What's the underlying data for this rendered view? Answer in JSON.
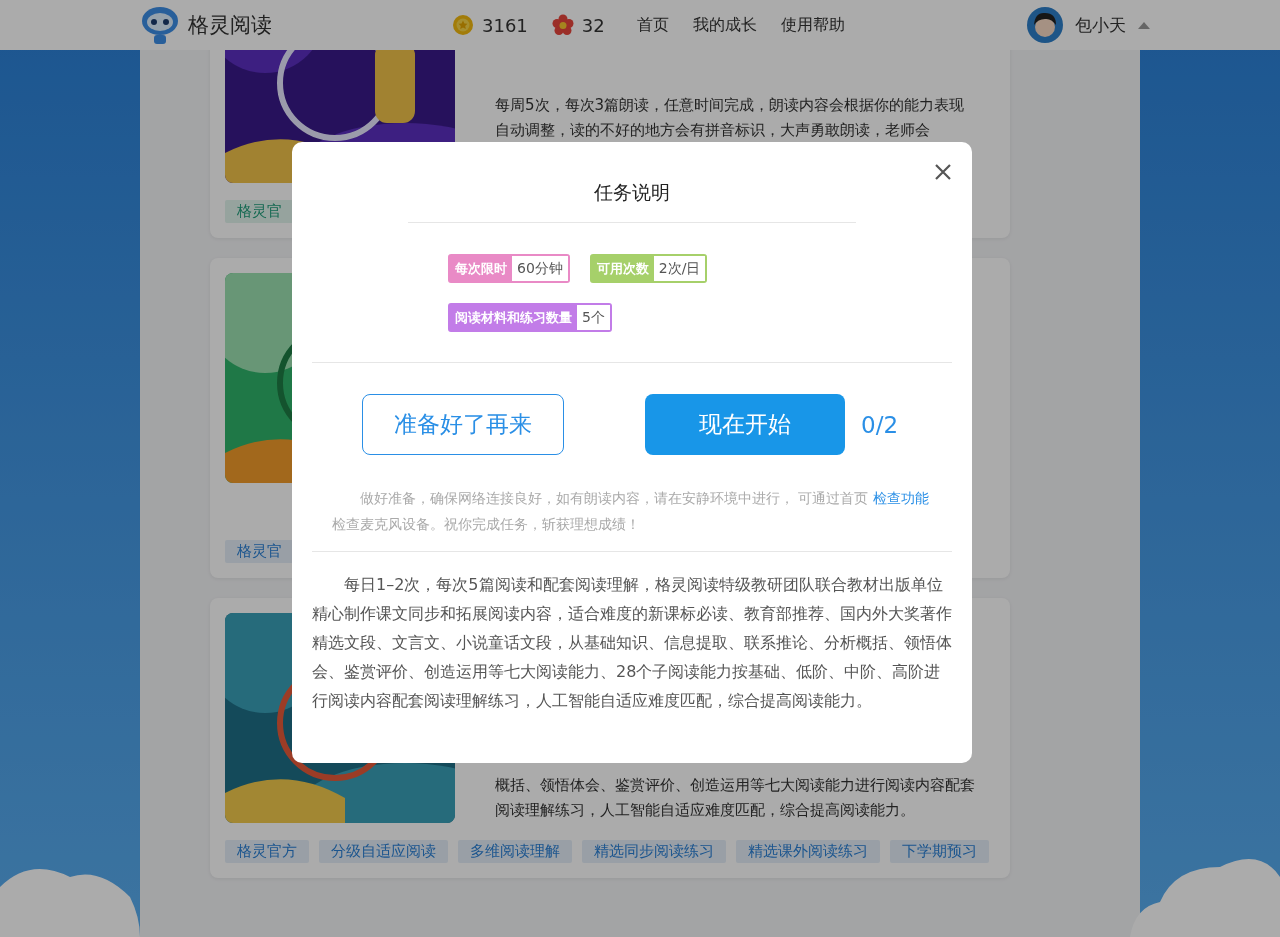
{
  "header": {
    "app_name": "格灵阅读",
    "coins": "3161",
    "flowers": "32",
    "nav": [
      {
        "label": "首页"
      },
      {
        "label": "我的成长"
      },
      {
        "label": "使用帮助"
      }
    ],
    "user_name": "包小天"
  },
  "cards": [
    {
      "description": "每周5次，每次3篇朗读，任意时间完成，朗读内容会根据你的能力表现自动调整，读的不好的地方会有拼音标识，大声勇敢朗读，老师会",
      "tags": [
        "格灵官"
      ]
    },
    {
      "tags": [
        "格灵官"
      ]
    },
    {
      "description": "概括、领悟体会、鉴赏评价、创造运用等七大阅读能力进行阅读内容配套阅读理解练习，人工智能自适应难度匹配，综合提高阅读能力。",
      "tags": [
        "格灵官方",
        "分级自适应阅读",
        "多维阅读理解",
        "精选同步阅读练习",
        "精选课外阅读练习",
        "下学期预习"
      ]
    }
  ],
  "dialog": {
    "title": "任务说明",
    "badges": [
      {
        "label": "每次限时",
        "value": "60分钟",
        "color": "#e98ac6"
      },
      {
        "label": "可用次数",
        "value": "2次/日",
        "color": "#a6d06a"
      },
      {
        "label": "阅读材料和练习数量",
        "value": "5个",
        "color": "#c27ce8"
      }
    ],
    "secondary_button": "准备好了再来",
    "primary_button": "现在开始",
    "attempts": "0/2",
    "note_before": "做好准备，确保网络连接良好，如有朗读内容，请在安静环境中进行， 可通过首页",
    "note_link": "检查功能",
    "note_after": "检查麦克风设备。祝你完成任务，斩获理想成绩！",
    "description": "每日1–2次，每次5篇阅读和配套阅读理解，格灵阅读特级教研团队联合教材出版单位精心制作课文同步和拓展阅读内容，适合难度的新课标必读、教育部推荐、国内外大奖著作精选文段、文言文、小说童话文段，从基础知识、信息提取、联系推论、分析概括、领悟体会、鉴赏评价、创造运用等七大阅读能力、28个子阅读能力按基础、低阶、中阶、高阶进行阅读内容配套阅读理解练习，人工智能自适应难度匹配，综合提高阅读能力。"
  }
}
